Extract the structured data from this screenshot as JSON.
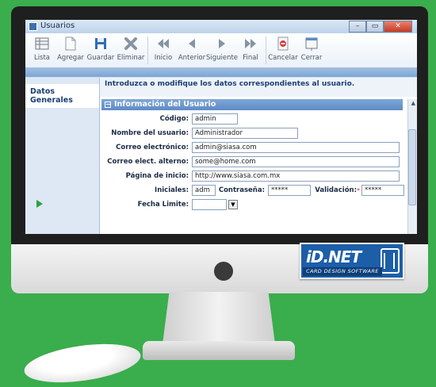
{
  "window": {
    "title": "Usuarios",
    "controls": [
      "–",
      "▭",
      "✕"
    ]
  },
  "toolbar": [
    {
      "label": "Lista",
      "icon": "list-icon"
    },
    {
      "label": "Agregar",
      "icon": "add-document-icon"
    },
    {
      "label": "Guardar",
      "icon": "save-icon"
    },
    {
      "label": "Eliminar",
      "icon": "delete-icon"
    },
    {
      "label": "Inicio",
      "icon": "first-icon"
    },
    {
      "label": "Anterior",
      "icon": "previous-icon"
    },
    {
      "label": "Siguiente",
      "icon": "next-icon"
    },
    {
      "label": "Final",
      "icon": "last-icon"
    },
    {
      "label": "Cancelar",
      "icon": "cancel-icon"
    },
    {
      "label": "Cerrar",
      "icon": "close-window-icon"
    }
  ],
  "nav": {
    "item": "Datos Generales"
  },
  "intro": "Introduzca o modifique los datos correspondientes al usuario.",
  "section": {
    "title": "Información del Usuario",
    "collapse": "−"
  },
  "form": {
    "codigo": {
      "label": "Código:",
      "value": "admin"
    },
    "nombre": {
      "label": "Nombre del usuario:",
      "value": "Administrador"
    },
    "correo": {
      "label": "Correo electrónico:",
      "value": "admin@siasa.com"
    },
    "correo_alt": {
      "label": "Correo elect. alterno:",
      "value": "some@home.com"
    },
    "pagina": {
      "label": "Página de inicio:",
      "value": "http://www.siasa.com.mx"
    },
    "iniciales": {
      "label": "Iniciales:",
      "value": "adm"
    },
    "contrasena": {
      "label": "Contraseña:",
      "value": "*****"
    },
    "validacion": {
      "label": "Validación:",
      "required": "*",
      "value": "*****"
    },
    "fecha": {
      "label": "Fecha Limite:",
      "value": ""
    }
  },
  "logo": {
    "main": "iD.NET",
    "sub": "CARD DESIGN SOFTWARE"
  },
  "colors": {
    "background": "#3aad4c",
    "accent": "#5d8bc6",
    "logo": "#1d5ea8"
  }
}
